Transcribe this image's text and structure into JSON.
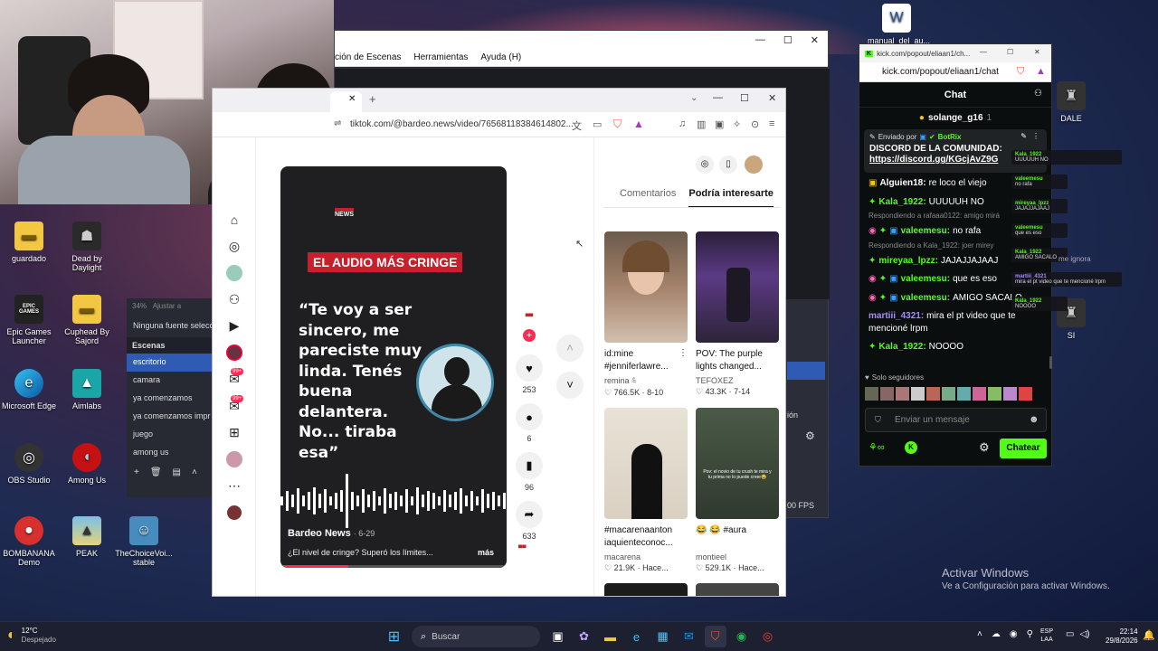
{
  "desktop": {
    "icons": [
      {
        "label": "guardado"
      },
      {
        "label": "Dead by Daylight"
      },
      {
        "label": "Epic Games Launcher"
      },
      {
        "label": "Cuphead By Sajord"
      },
      {
        "label": "Microsoft Edge"
      },
      {
        "label": "Aimlabs"
      },
      {
        "label": "OBS Studio"
      },
      {
        "label": "Among Us"
      },
      {
        "label": "BOMBANANA Demo"
      },
      {
        "label": "PEAK"
      },
      {
        "label": "TheChoiceVoi... stable"
      },
      {
        "label": "manual_del_au..."
      },
      {
        "label": "DALE"
      },
      {
        "label": "SI"
      }
    ],
    "epic_logo": "EPIC GAMES",
    "activate_title": "Activar Windows",
    "activate_sub": "Ve a Configuración para activar Windows."
  },
  "obs": {
    "menu": [
      "ción de Escenas",
      "Herramientas",
      "Ayuda (H)"
    ],
    "zoom": "34%",
    "adjust": "Ajustar a",
    "no_source": "Ninguna fuente selecc",
    "scenes_title": "Escenas",
    "scenes": [
      "escritorio",
      "camara",
      "ya comenzamos",
      "ya comenzamos impr",
      "juego",
      "among us"
    ],
    "fps": "00 FPS",
    "side_text": "ión"
  },
  "browser": {
    "url": "tiktok.com/@bardeo.news/video/76568118384614802...",
    "video": {
      "brand": "NEWS",
      "headline": "EL AUDIO MÁS CRINGE",
      "quote": "“Te voy a ser sincero, me pareciste muy linda. Tenés buena delantera. No... tiraba esa”",
      "author": "Bardeo News",
      "date": "· 6-29",
      "caption": "¿El nivel de cringe? Superó los límites...",
      "more": "más"
    },
    "rail_badges": [
      "99+",
      "99+"
    ],
    "actions": {
      "likes": "253",
      "comments": "6",
      "saves": "96",
      "shares": "633"
    },
    "tabs": [
      "Comentarios",
      "Podría interesarte"
    ],
    "cards": [
      {
        "title": "id:mine #jenniferlawre...",
        "author": "remina ⩯",
        "views": "766.5K",
        "date": "· 8-10"
      },
      {
        "title": "POV: The purple lights changed...",
        "author": "TEFOXEZ",
        "views": "43.3K",
        "date": "· 7-14"
      },
      {
        "title": "#macarenaanton iaquienteconoc...",
        "author": "macarena",
        "views": "21.9K",
        "date": "· Hace..."
      },
      {
        "title": "😂 😂 #aura",
        "author": "montieel",
        "views": "529.1K",
        "date": "· Hace..."
      }
    ],
    "card_overlays": [
      "Pov: el novio de tu crush te mira y tu prima no lo puede creer😂"
    ]
  },
  "kick": {
    "tab_url": "kick.com/popout/eliaan1/ch...",
    "url": "kick.com/popout/eliaan1/chat",
    "title": "Chat",
    "top_user": "solange_g16",
    "top_count": "1",
    "pinned_by": "Enviado por",
    "pinned_user": "BotRix",
    "pinned_text": "DISCORD DE LA COMUNIDAD:",
    "pinned_link": "https://discord.gg/KGcjAvZ9G",
    "messages": [
      {
        "user": "Alguien18:",
        "text": "re loco el viejo",
        "color": "#ffffff"
      },
      {
        "user": "Kala_1922:",
        "text": "UUUUUH NO",
        "color": "#53fc18"
      },
      {
        "reply": "Respondiendo a rafaaa0122: amigo mirá"
      },
      {
        "user": "valeemesu:",
        "text": "no rafa",
        "color": "#53fc18"
      },
      {
        "reply": "Respondiendo a Kala_1922: joer mirey"
      },
      {
        "user": "mireyaa_lpzz:",
        "text": "JAJAJJAJAAJ",
        "color": "#53fc18"
      },
      {
        "user": "valeemesu:",
        "text": "que es eso",
        "color": "#53fc18"
      },
      {
        "user": "valeemesu:",
        "text": "AMIGO SACALO",
        "color": "#53fc18"
      },
      {
        "user": "martiii_4321:",
        "text": "mira el pt video que te mencioné lrpm",
        "color": "#a68bff"
      },
      {
        "user": "Kala_1922:",
        "text": "NOOOO",
        "color": "#53fc18"
      }
    ],
    "followers_only": "Solo seguidores",
    "input_placeholder": "Enviar un mensaje",
    "send": "Chatear"
  },
  "overlay": [
    {
      "user": "Kala_1922",
      "text": "UUUUUH NO"
    },
    {
      "user": "valeemesu",
      "text": "no rafa"
    },
    {
      "user": "mireyaa_lpzz",
      "text": "JAJAJJAJAAJ"
    },
    {
      "user": "valeemesu",
      "text": "que es eso"
    },
    {
      "user": "Kala_1922",
      "text": "AMIGO SACALO"
    },
    {
      "user": "martiii_4321",
      "text": "mira el pt video que te mencioné lrpm"
    },
    {
      "user": "Kala_1922",
      "text": "NOOOO"
    }
  ],
  "overlay_ignore": "me ignora",
  "taskbar": {
    "weather_temp": "12°C",
    "weather_desc": "Despejado",
    "search": "Buscar",
    "lang1": "ESP",
    "lang2": "LAA",
    "time": "22:14",
    "date": "29/8/2026"
  }
}
